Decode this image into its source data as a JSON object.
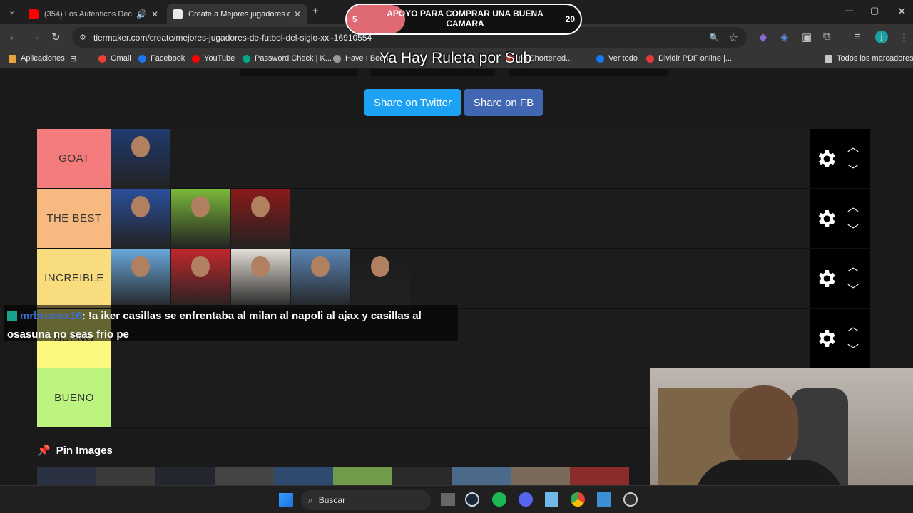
{
  "tabs": [
    {
      "title": "(354) Los Auténticos Decad",
      "active": false
    },
    {
      "title": "Create a Mejores jugadores de",
      "active": true
    }
  ],
  "address": "tiermaker.com/create/mejores-jugadores-de-futbol-del-siglo-xxi-16910554",
  "bookmarks": [
    "Aplicaciones",
    "Gmail",
    "Facebook",
    "YouTube",
    "Password Check | K...",
    "Have I Been...",
    "nd Shortened...",
    "Ver todo",
    "Dividir PDF online |...",
    "Todos los marcadores"
  ],
  "overlay": {
    "goal_label": "APOYO PARA COMPRAR UNA BUENA CAMARA",
    "goal_current": "5",
    "goal_target": "20",
    "ruleta_text": "Ya Hay Ruleta por Sub"
  },
  "share": {
    "twitter": "Share on Twitter",
    "fb": "Share on FB"
  },
  "tiers": [
    {
      "label": "GOAT",
      "color": "#f47c7c",
      "players": 1
    },
    {
      "label": "THE BEST",
      "color": "#f7b97f",
      "players": 3
    },
    {
      "label": "INCREIBLE",
      "color": "#f9dc7e",
      "players": 5
    },
    {
      "label": "BUENO",
      "color": "#fbfa7f",
      "players": 0
    },
    {
      "label": "BUENO",
      "color": "#bdf47f",
      "players": 0
    }
  ],
  "chat": {
    "user": "mrbrunox16",
    "message": ": !a iker casillas se enfrentaba al milan al napoli al ajax y casillas al osasuna no seas frio pe"
  },
  "pin": {
    "label": "Pin Images"
  },
  "taskbar": {
    "search": "Buscar"
  }
}
